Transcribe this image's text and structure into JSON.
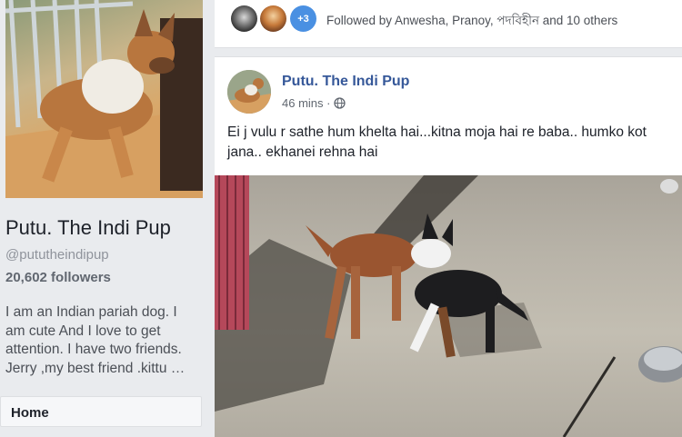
{
  "sidebar": {
    "page_name": "Putu. The Indi Pup",
    "handle": "@pututheindipup",
    "followers": "20,602 followers",
    "about_lines": [
      "I am an Indian pariah dog. I",
      "am cute And I love to get",
      "attention. I have two friends.",
      "Jerry ,my best friend .kittu …"
    ],
    "nav_home": "Home"
  },
  "followed_bar": {
    "more_count": "+3",
    "text": "Followed by Anwesha, Pranoy, পদবিহীন and 10 others"
  },
  "post": {
    "author": "Putu. The Indi Pup",
    "time": "46 mins ·",
    "privacy_icon": "globe-icon",
    "text_lines": [
      "Ei j vulu r sathe hum khelta hai...kitna moja hai re baba.. humko kot",
      "jana.. ekhanei rehna hai"
    ]
  },
  "colors": {
    "link_blue": "#365899",
    "accent_blue": "#4a90e2",
    "background": "#e9ebee"
  }
}
